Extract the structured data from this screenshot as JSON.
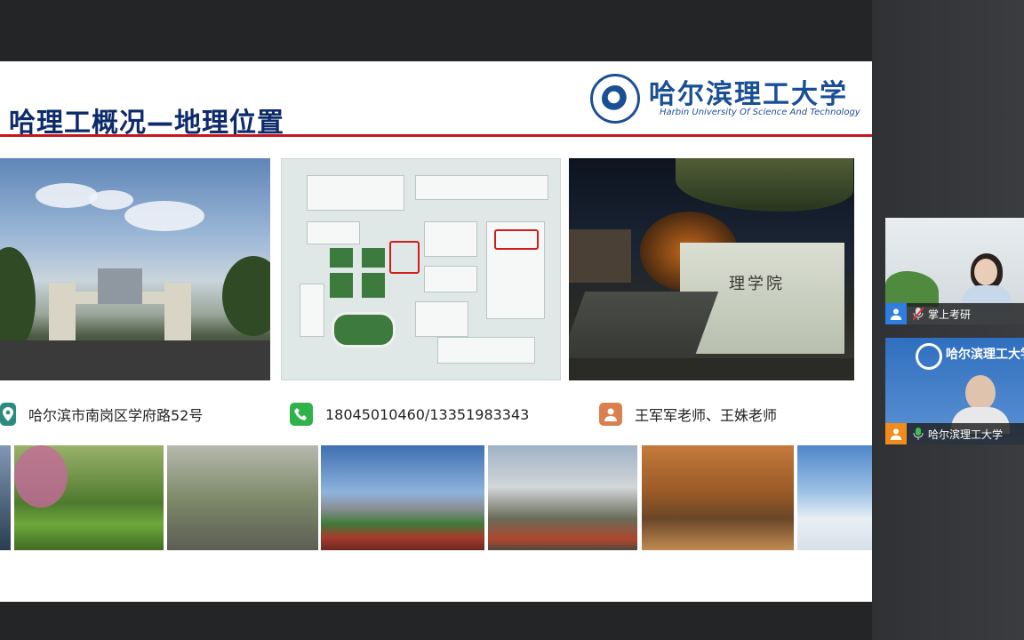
{
  "slide": {
    "title": "哈理工概况—地理位置",
    "logo": {
      "name_cn": "哈尔滨理工大学",
      "name_en": "Harbin University Of Science And Technology"
    },
    "contacts": [
      {
        "icon": "location-pin-icon",
        "text": "哈尔滨市南岗区学府路52号"
      },
      {
        "icon": "phone-icon",
        "text": "18045010460/13351983343"
      },
      {
        "icon": "person-icon",
        "text": "王军军老师、王姝老师"
      }
    ],
    "photo_sign_text": "理学院",
    "colors": {
      "title": "#0d2a6b",
      "rule": "#c8161d",
      "logo": "#1a4f96",
      "phone": "#2fb24a",
      "person": "#d9804e",
      "location": "#2a8c7e"
    }
  },
  "participants": [
    {
      "name": "掌上考研",
      "mic": "muted",
      "avatar": "person-icon",
      "avatar_color": "#2f7de1"
    },
    {
      "name": "哈尔滨理工大学",
      "mic": "on",
      "avatar": "person-icon",
      "avatar_color": "#f08c1c",
      "background_logo": "哈尔滨理工大学"
    }
  ]
}
